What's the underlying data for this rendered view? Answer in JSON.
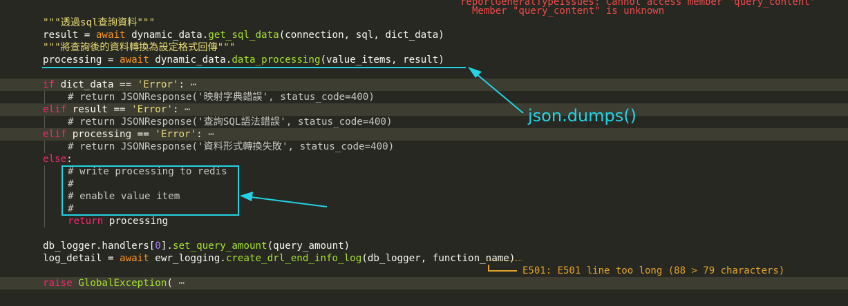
{
  "diagnostics": {
    "top_line1": "reportGeneralTypeIssues: Cannot access member \"query_content\"",
    "top_line2": "Member \"query_content\" is unknown",
    "e501": "E501: E501 line too long (88 > 79 characters)"
  },
  "annotation": {
    "json_label": "json.dumps()"
  },
  "code": {
    "l1": {
      "str": "\"\"\"透過sql查詢資料\"\"\""
    },
    "l2": {
      "a": "result = ",
      "await": "await",
      "b": " dynamic_data.",
      "fn": "get_sql_data",
      "c": "(connection, sql, dict_data)"
    },
    "l3": {
      "str": "\"\"\"將查詢後的資料轉換為設定格式回傳\"\"\""
    },
    "l4": {
      "a": "processing = ",
      "await": "await",
      "b": " dynamic_data.",
      "fn": "data_processing",
      "c": "(value_items, result)"
    },
    "l6": {
      "kw": "if",
      "a": " dict_data == ",
      "str": "'Error'",
      "b": ": ",
      "fold": "⋯"
    },
    "l7": {
      "cm": "# return JSONResponse('映射字典錯誤', status_code=400)"
    },
    "l8": {
      "kw": "elif",
      "a": " result == ",
      "str": "'Error'",
      "b": ": ",
      "fold": "⋯"
    },
    "l9": {
      "cm": "# return JSONResponse('查詢SQL語法錯誤', status_code=400)"
    },
    "l10": {
      "kw": "elif",
      "a": " processing == ",
      "str": "'Error'",
      "b": ": ",
      "fold": "⋯"
    },
    "l11": {
      "cm": "# return JSONResponse('資料形式轉換失敗', status_code=400)"
    },
    "l12": {
      "kw": "else",
      "a": ":"
    },
    "l13": {
      "cm": "# write processing to redis"
    },
    "l14": {
      "cm": "#"
    },
    "l15": {
      "cm": "# enable value item"
    },
    "l16": {
      "cm": "#"
    },
    "l17": {
      "kw": "return",
      "a": " processing"
    },
    "l19": {
      "a": "db_logger.handlers[",
      "num": "0",
      "b": "].",
      "fn": "set_query_amount",
      "c": "(query_amount)"
    },
    "l20": {
      "a": "log_detail = ",
      "await": "await",
      "b": " ewr_logging.",
      "fn": "create_drl_end_info_log",
      "c": "(db_logger, function_name)"
    },
    "l22": {
      "kw": "raise",
      "a": " ",
      "fn": "GlobalException",
      "b": "( ",
      "fold": "⋯"
    }
  }
}
